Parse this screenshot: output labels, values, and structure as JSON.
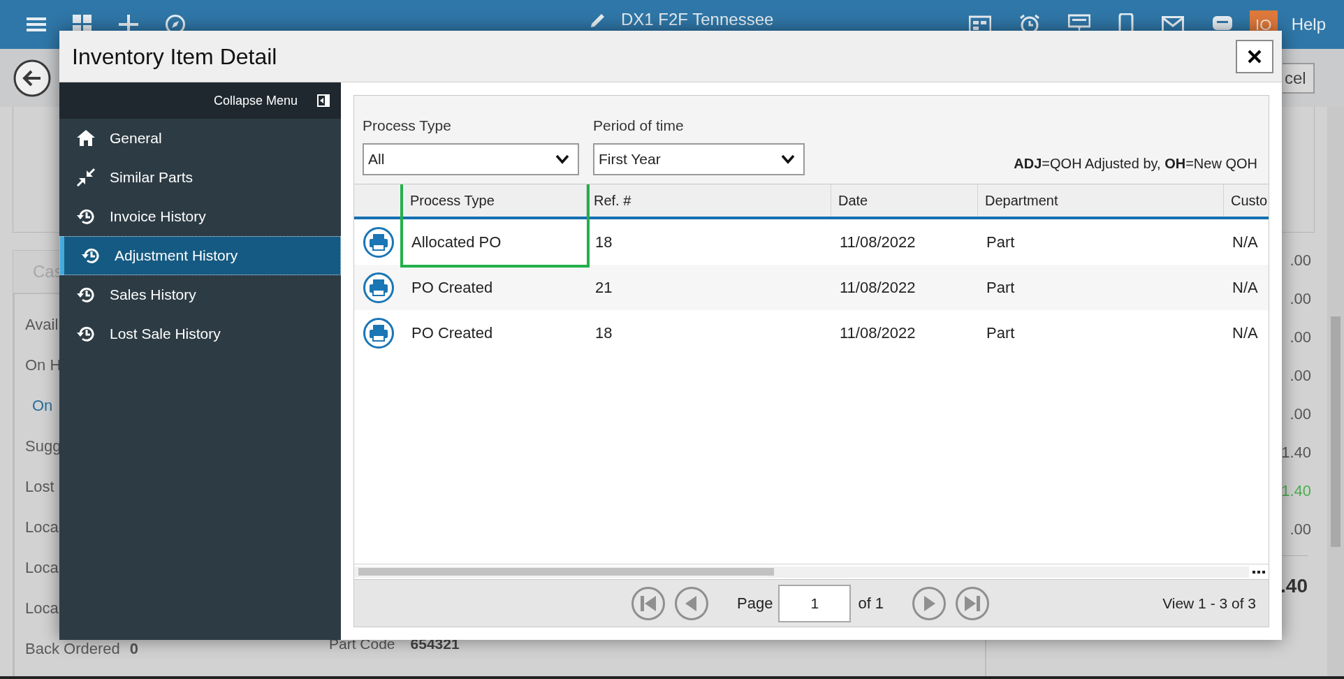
{
  "header": {
    "title": "DX1 F2F Tennessee",
    "avatar": "IO",
    "help": "Help"
  },
  "page": {
    "cancel_button": "cel",
    "tab": "Cas",
    "labels": [
      {
        "text": "Avail",
        "kind": "label"
      },
      {
        "text": "On H",
        "kind": "label"
      },
      {
        "text": "On",
        "kind": "link"
      },
      {
        "text": "Sugg",
        "kind": "label"
      },
      {
        "text": "Lost",
        "kind": "label"
      },
      {
        "text": "Loca",
        "kind": "label"
      },
      {
        "text": "Loca",
        "kind": "label"
      },
      {
        "text": "Loca",
        "kind": "label"
      },
      {
        "text": "Back Ordered",
        "kind": "label"
      }
    ],
    "back_ordered_value": "0",
    "part_code": {
      "label": "Part Code",
      "value": "654321"
    },
    "values": [
      {
        "text": ".00",
        "color": "#555555"
      },
      {
        "text": ".00",
        "color": "#555555"
      },
      {
        "text": ".00",
        "color": "#555555"
      },
      {
        "text": ".00",
        "color": "#555555"
      },
      {
        "text": ".00",
        "color": "#555555"
      },
      {
        "text": "1.40",
        "color": "#555555"
      },
      {
        "text": "1.40",
        "color": "#4caf50"
      },
      {
        "text": ".00",
        "color": "#555555"
      }
    ],
    "total": ".40"
  },
  "dialog": {
    "title": "Inventory Item Detail",
    "menu": {
      "collapse": "Collapse Menu",
      "items": [
        {
          "label": "General",
          "kind": "home",
          "selected": false
        },
        {
          "label": "Similar Parts",
          "kind": "shrink",
          "selected": false
        },
        {
          "label": "Invoice History",
          "kind": "history",
          "selected": false
        },
        {
          "label": "Adjustment History",
          "kind": "history",
          "selected": true
        },
        {
          "label": "Sales History",
          "kind": "history",
          "selected": false
        },
        {
          "label": "Lost Sale History",
          "kind": "history",
          "selected": false
        }
      ]
    },
    "filters": [
      {
        "label": "Process Type",
        "value": "All"
      },
      {
        "label": "Period of time",
        "value": "First Year"
      }
    ],
    "legend": "**ADJ**=QOH Adjusted by, **OH**=New QOH",
    "table": {
      "columns": [
        {
          "label": "Process Type",
          "highlighted": true
        },
        {
          "label": "Ref. #",
          "highlighted": false
        },
        {
          "label": "Date",
          "highlighted": false
        },
        {
          "label": "Department",
          "highlighted": false
        },
        {
          "label": "Custo",
          "highlighted": false
        }
      ],
      "rows": [
        {
          "cells": [
            "Allocated PO",
            "18",
            "11/08/2022",
            "Part",
            "N/A"
          ]
        },
        {
          "cells": [
            "PO Created",
            "21",
            "11/08/2022",
            "Part",
            "N/A"
          ]
        },
        {
          "cells": [
            "PO Created",
            "18",
            "11/08/2022",
            "Part",
            "N/A"
          ]
        }
      ]
    },
    "pager": {
      "page_label": "Page",
      "page": "1",
      "of": "of 1",
      "summary": "View 1 - 3 of 3"
    }
  }
}
